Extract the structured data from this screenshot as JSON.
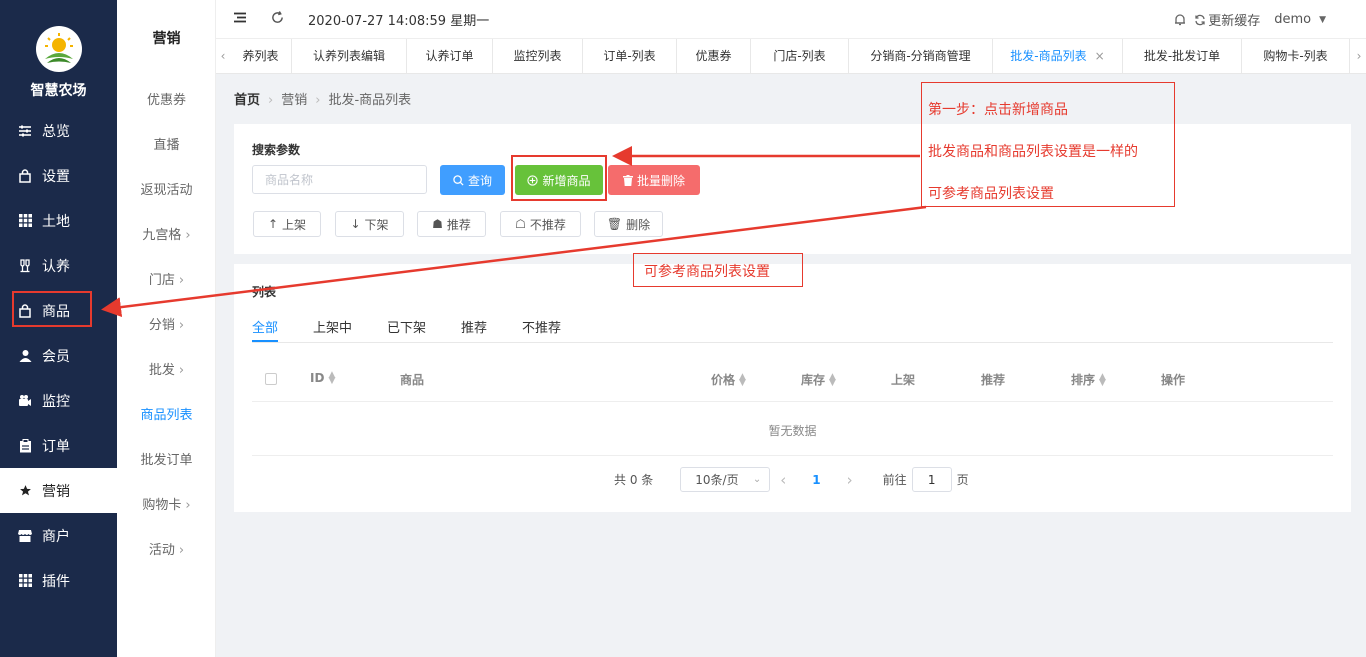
{
  "brand": {
    "name": "智慧农场"
  },
  "sidebar": {
    "items": [
      {
        "label": "总览",
        "icon": "sliders-icon"
      },
      {
        "label": "设置",
        "icon": "bag-icon"
      },
      {
        "label": "土地",
        "icon": "grid-icon"
      },
      {
        "label": "认养",
        "icon": "cheers-icon"
      },
      {
        "label": "商品",
        "icon": "bag-icon"
      },
      {
        "label": "会员",
        "icon": "user-icon"
      },
      {
        "label": "监控",
        "icon": "camera-icon"
      },
      {
        "label": "订单",
        "icon": "clipboard-icon"
      },
      {
        "label": "营销",
        "icon": "star-icon"
      },
      {
        "label": "商户",
        "icon": "shop-icon"
      },
      {
        "label": "插件",
        "icon": "grid-icon"
      }
    ],
    "active": "营销"
  },
  "subnav": {
    "title": "营销",
    "items": [
      {
        "label": "优惠券"
      },
      {
        "label": "直播"
      },
      {
        "label": "返现活动"
      },
      {
        "label": "九宫格",
        "chevron": "›"
      },
      {
        "label": "门店",
        "chevron": "›"
      },
      {
        "label": "分销",
        "chevron": "›"
      },
      {
        "label": "批发",
        "chevron": "›"
      },
      {
        "label": "商品列表"
      },
      {
        "label": "批发订单"
      },
      {
        "label": "购物卡",
        "chevron": "›"
      },
      {
        "label": "活动",
        "chevron": "›"
      }
    ]
  },
  "topbar": {
    "datetime": "2020-07-27 14:08:59 星期一",
    "cache_label": "更新缓存",
    "user": "demo"
  },
  "tabs": {
    "items": [
      {
        "label": "养列表"
      },
      {
        "label": "认养列表编辑"
      },
      {
        "label": "认养订单"
      },
      {
        "label": "监控列表"
      },
      {
        "label": "订单-列表"
      },
      {
        "label": "优惠券"
      },
      {
        "label": "门店-列表"
      },
      {
        "label": "分销商-分销商管理"
      },
      {
        "label": "批发-商品列表",
        "close": "×"
      },
      {
        "label": "批发-批发订单"
      },
      {
        "label": "购物卡-列表"
      }
    ]
  },
  "breadcrumb": {
    "home": "首页",
    "section": "营销",
    "page": "批发-商品列表"
  },
  "search": {
    "label": "搜索参数",
    "placeholder": "商品名称",
    "query_btn": "查询",
    "add_btn": "新增商品",
    "batch_delete_btn": "批量删除",
    "actions": [
      {
        "label": "上架",
        "icon": "↑"
      },
      {
        "label": "下架",
        "icon": "↓"
      },
      {
        "label": "推荐",
        "icon": "☗"
      },
      {
        "label": "不推荐",
        "icon": "☖"
      },
      {
        "label": "删除",
        "icon": "🗑"
      }
    ]
  },
  "list": {
    "label": "列表",
    "filter_tabs": [
      "全部",
      "上架中",
      "已下架",
      "推荐",
      "不推荐"
    ],
    "columns": [
      "ID",
      "商品",
      "价格",
      "库存",
      "上架",
      "推荐",
      "排序",
      "操作"
    ],
    "empty": "暂无数据",
    "pager": {
      "total": "共 0 条",
      "page_size": "10条/页",
      "current": "1",
      "goto": "前往",
      "goto_value": "1",
      "page_unit": "页"
    }
  },
  "annotations": {
    "step_title": "第一步：点击新增商品",
    "line2": "批发商品和商品列表设置是一样的",
    "line3": "可参考商品列表设置",
    "side_note": "可参考商品列表设置",
    "color": "#e63a2e"
  }
}
